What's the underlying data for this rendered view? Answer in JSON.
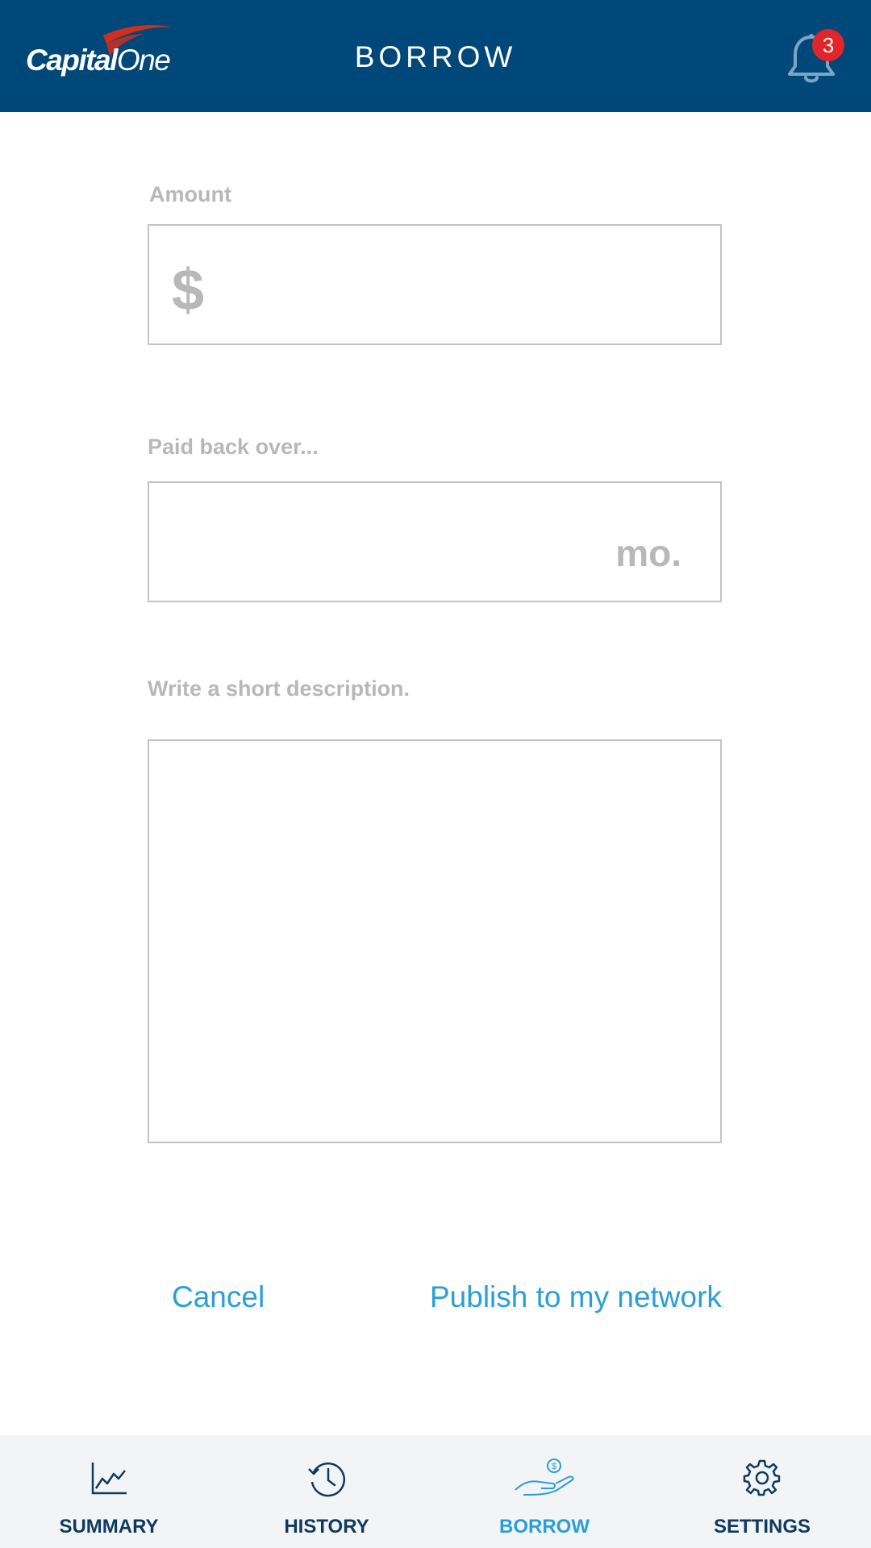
{
  "header": {
    "brand": "CapitalOne",
    "brand_part1": "Capital",
    "brand_part2": "One",
    "title": "BORROW",
    "notification_count": "3",
    "colors": {
      "background": "#004879",
      "badge": "#e0252b"
    }
  },
  "form": {
    "amount_label": "Amount",
    "amount_prefix": "$",
    "amount_value": "",
    "payback_label": "Paid back over...",
    "payback_suffix": "mo.",
    "payback_value": "",
    "description_label": "Write a short description.",
    "description_value": ""
  },
  "actions": {
    "cancel_label": "Cancel",
    "publish_label": "Publish to my network",
    "color": "#2a9fd6"
  },
  "bottom_nav": {
    "items": [
      {
        "label": "SUMMARY",
        "icon": "line-chart-icon",
        "active": false
      },
      {
        "label": "HISTORY",
        "icon": "history-clock-icon",
        "active": false
      },
      {
        "label": "BORROW",
        "icon": "hand-coin-icon",
        "active": true
      },
      {
        "label": "SETTINGS",
        "icon": "gear-icon",
        "active": false
      }
    ],
    "active_color": "#2a9fd6",
    "inactive_color": "#0e3a5f"
  }
}
